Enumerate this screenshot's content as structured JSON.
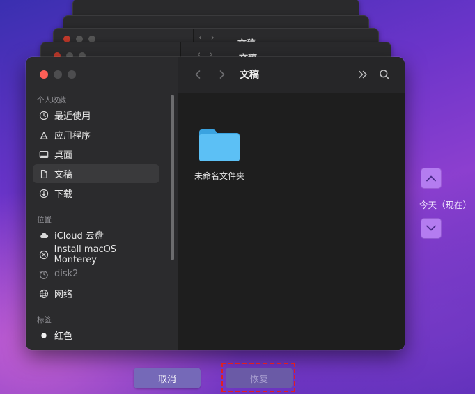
{
  "window": {
    "title": "文稿",
    "traffic_lights": {
      "close_color": "#fe5f57",
      "inactive_color": "#4d4d4f"
    }
  },
  "background_windows": {
    "title": "文稿"
  },
  "sidebar": {
    "sections": [
      {
        "label": "个人收藏",
        "items": [
          {
            "label": "最近使用",
            "icon": "clock-icon"
          },
          {
            "label": "应用程序",
            "icon": "applications-icon"
          },
          {
            "label": "桌面",
            "icon": "desktop-icon"
          },
          {
            "label": "文稿",
            "icon": "document-icon",
            "selected": true
          },
          {
            "label": "下载",
            "icon": "download-icon"
          }
        ]
      },
      {
        "label": "位置",
        "items": [
          {
            "label": "iCloud 云盘",
            "icon": "cloud-icon"
          },
          {
            "label": "Install macOS Monterey",
            "icon": "disk-icon"
          },
          {
            "label": "disk2",
            "icon": "time-machine-icon",
            "muted": true
          },
          {
            "label": "网络",
            "icon": "globe-icon"
          }
        ]
      },
      {
        "label": "标签",
        "items": [
          {
            "label": "红色",
            "icon": "tag-dot-icon"
          }
        ]
      }
    ]
  },
  "content": {
    "items": [
      {
        "name": "未命名文件夹",
        "type": "folder",
        "icon": "folder-icon",
        "color": "#4fb6f0"
      }
    ]
  },
  "time_machine": {
    "timeline_label": "今天（现在）",
    "accent_color": "#b47cf0"
  },
  "buttons": {
    "cancel": "取消",
    "restore": "恢复"
  }
}
